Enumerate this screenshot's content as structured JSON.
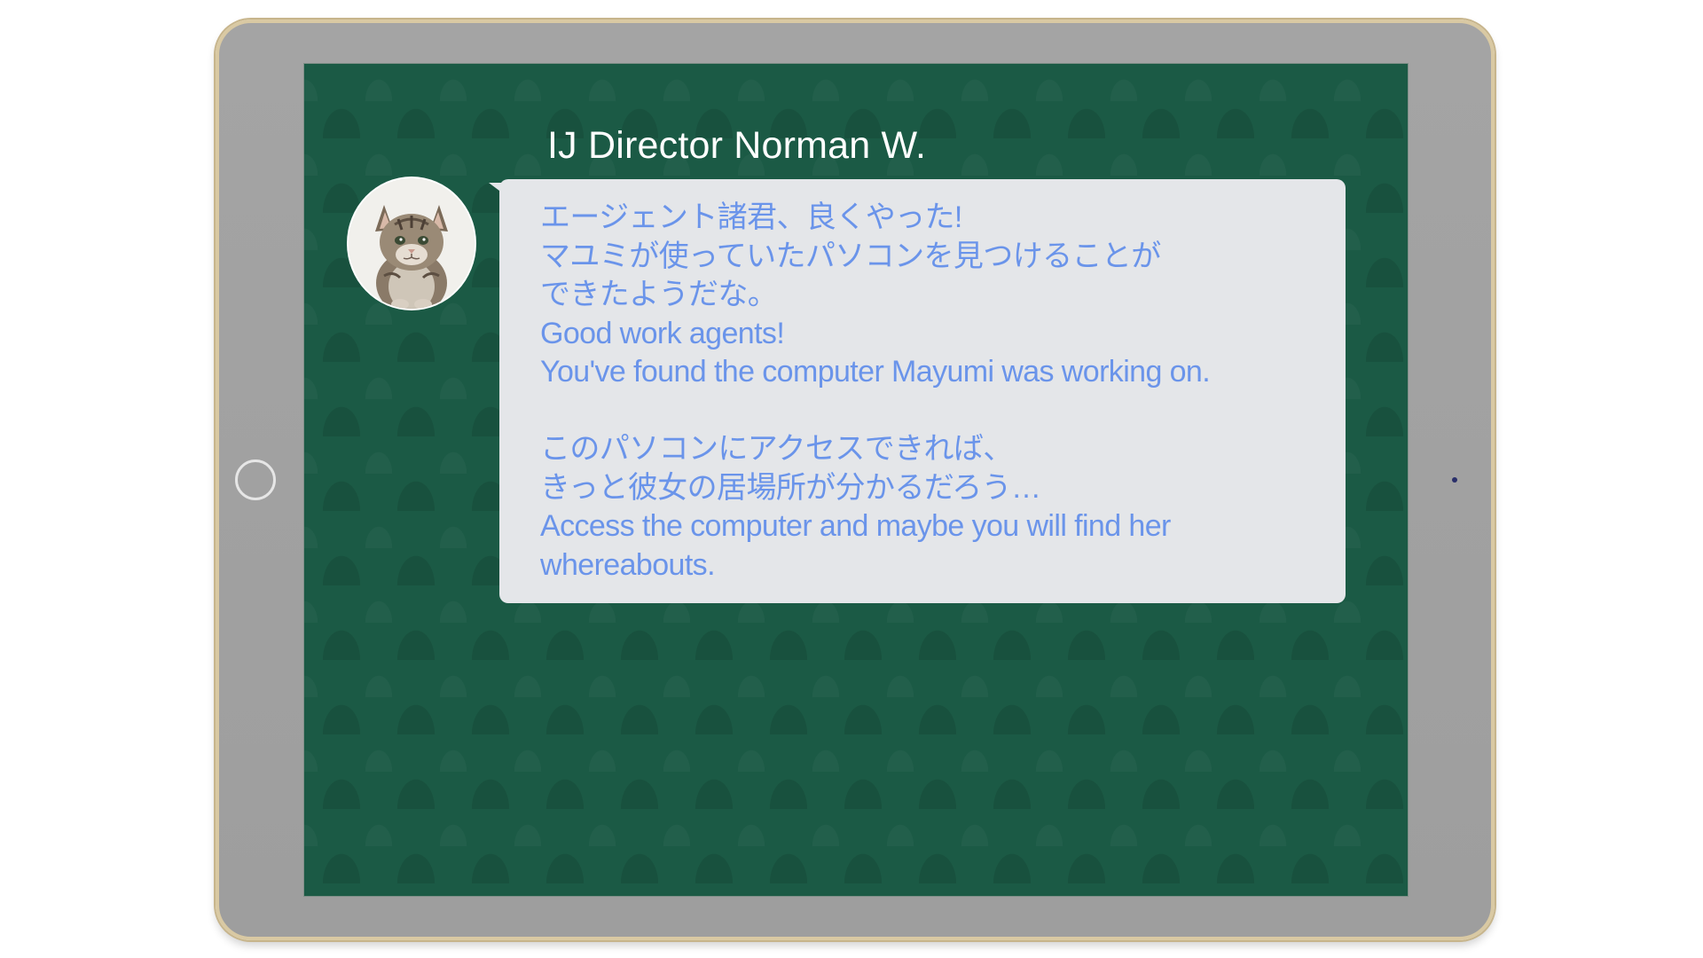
{
  "speaker": {
    "name": "IJ Director Norman W.",
    "avatar_icon": "kitten-portrait"
  },
  "message": {
    "lines": [
      "エージェント諸君、良くやった!",
      "マユミが使っていたパソコンを見つけることが",
      "できたようだな。",
      "Good work agents!",
      "You've found the computer Mayumi was working on.",
      "",
      "このパソコンにアクセスできれば、",
      "きっと彼女の居場所が分かるだろう…",
      "Access the computer and maybe you will find her",
      "whereabouts."
    ]
  },
  "colors": {
    "screen_background": "#1b5a45",
    "bubble_background": "#e4e6e9",
    "message_text": "#6a94ea",
    "name_text": "#ffffff",
    "tablet_frame": "#a4a4a4",
    "tablet_trim": "#d9c9a3"
  }
}
